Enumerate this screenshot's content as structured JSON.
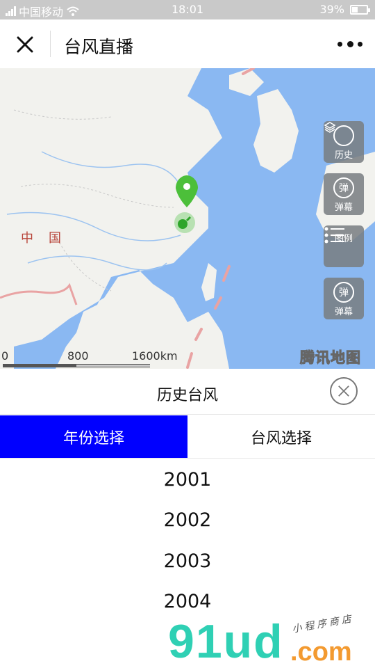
{
  "status_bar": {
    "carrier": "中国移动",
    "time": "18:01",
    "battery_pct": "39%",
    "battery_level": 0.39
  },
  "nav": {
    "title": "台风直播",
    "close_icon": "close-icon",
    "more_icon": "more-icon"
  },
  "map": {
    "country_label": "中国",
    "buttons": [
      {
        "label": "历史",
        "icon": "layers-icon"
      },
      {
        "label": "弹幕",
        "icon_text": "弹",
        "icon": "barrage-icon"
      },
      {
        "label": "图例",
        "icon": "list-icon"
      },
      {
        "label": "弹幕",
        "icon_text": "弹",
        "icon": "barrage-icon"
      }
    ],
    "scale": {
      "s0": "0",
      "s1": "800",
      "s2": "1600km"
    },
    "attribution": "腾讯地图",
    "colors": {
      "sea": "#8ab8f2",
      "land": "#f2f2ee",
      "marker": "#4cbf3a",
      "border": "#e9a3a3"
    }
  },
  "panel": {
    "title": "历史台风",
    "tabs": [
      {
        "label": "年份选择",
        "active": true
      },
      {
        "label": "台风选择",
        "active": false
      }
    ],
    "years": [
      "2001",
      "2002",
      "2003",
      "2004"
    ],
    "accent": "#0000ff"
  },
  "watermark": {
    "brand": "91ud",
    "suffix": ".com",
    "tagline": "小程序商店"
  }
}
